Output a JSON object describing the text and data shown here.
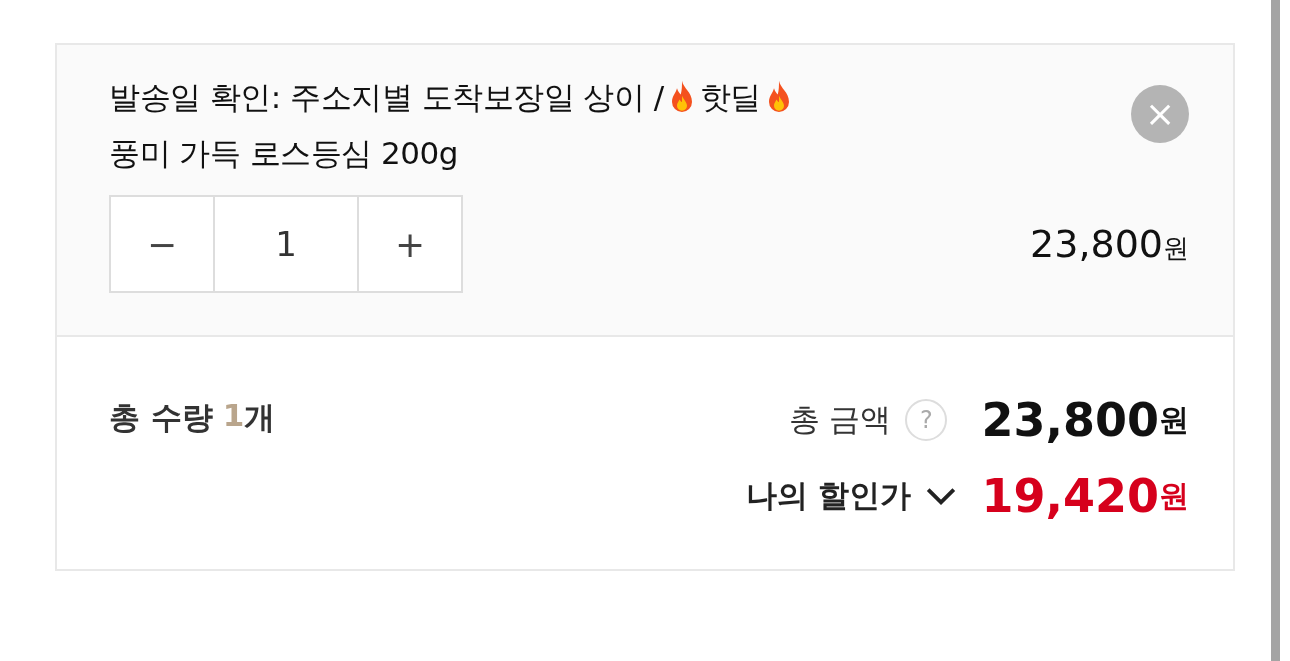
{
  "item": {
    "title_parts": [
      {
        "kind": "text",
        "text": "발송일 확인: 주소지별 도착보장일 상이 /"
      },
      {
        "kind": "flame"
      },
      {
        "kind": "text",
        "text": "핫딜"
      },
      {
        "kind": "flame"
      },
      {
        "kind": "text",
        "text": "풍미 가득 로스등심 200g"
      }
    ],
    "close": "×",
    "stepper": {
      "minus": "−",
      "quantity": "1",
      "plus": "+"
    },
    "price": {
      "amount": "23,800",
      "unit": "원"
    }
  },
  "summary": {
    "quantity": {
      "label": "총 수량",
      "count": "1",
      "unit": "개"
    },
    "total": {
      "label": "총 금액",
      "help": "?",
      "amount": "23,800",
      "unit": "원"
    },
    "discount": {
      "label": "나의 할인가",
      "amount": "19,420",
      "unit": "원"
    }
  }
}
